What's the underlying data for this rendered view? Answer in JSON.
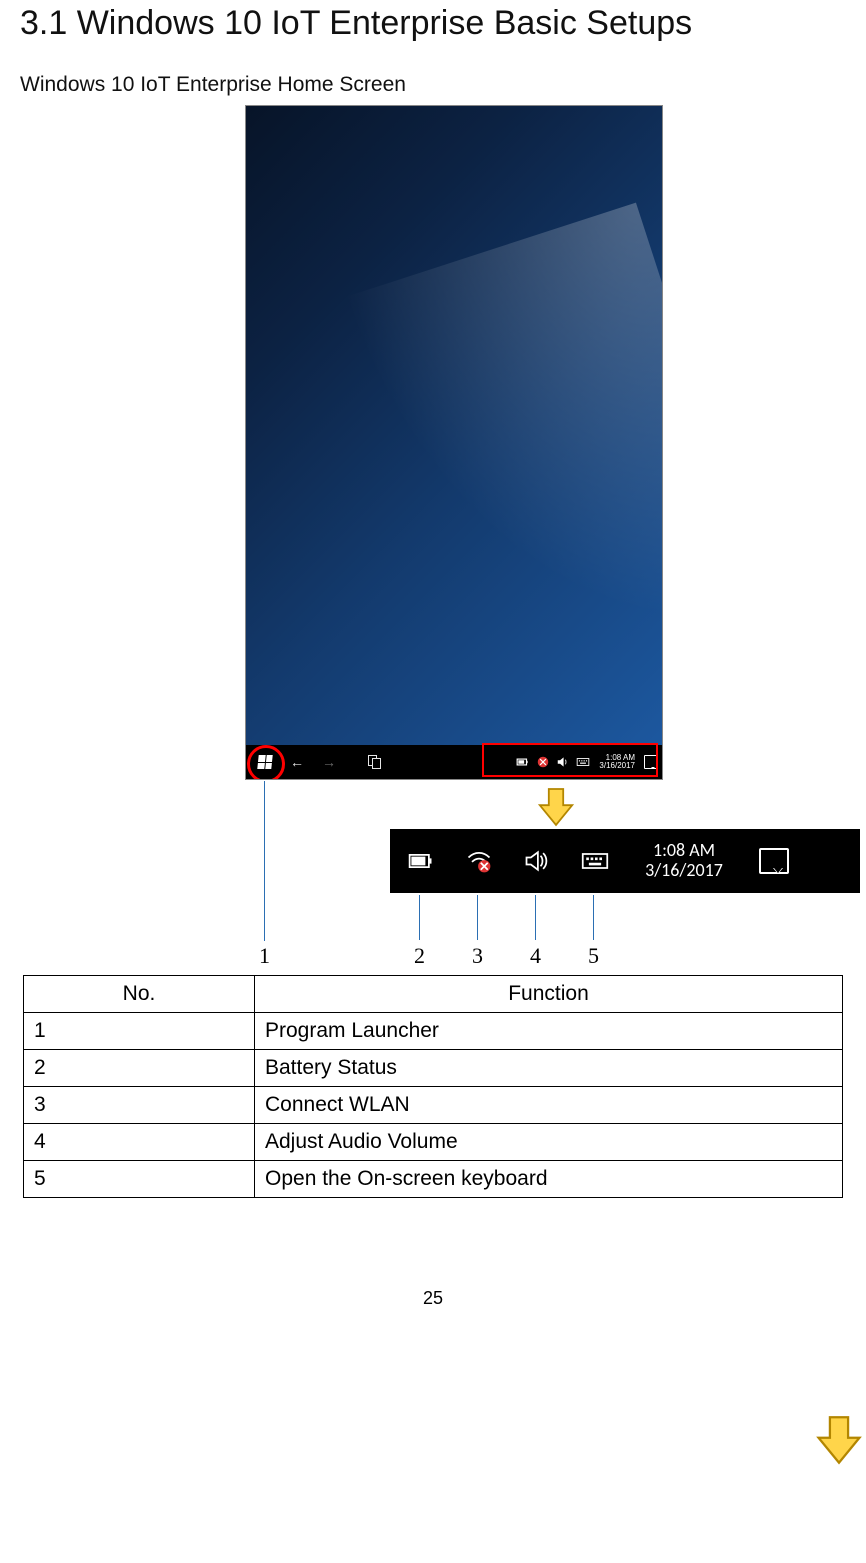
{
  "section_title": "3.1 Windows 10 IoT Enterprise Basic Setups",
  "subtitle": "Windows 10 IoT Enterprise Home Screen",
  "taskbar": {
    "time_small": "1:08 AM",
    "date_small": "3/16/2017"
  },
  "tray_big": {
    "time": "1:08 AM",
    "date": "3/16/2017"
  },
  "callout_numbers": [
    "1",
    "2",
    "3",
    "4",
    "5"
  ],
  "table": {
    "headers": [
      "No.",
      "Function"
    ],
    "rows": [
      {
        "no": "1",
        "fn": "Program Launcher"
      },
      {
        "no": "2",
        "fn": "Battery Status"
      },
      {
        "no": "3",
        "fn": "Connect WLAN"
      },
      {
        "no": "4",
        "fn": "Adjust Audio Volume"
      },
      {
        "no": "5",
        "fn": "Open the On-screen keyboard"
      }
    ]
  },
  "page_number": "25"
}
